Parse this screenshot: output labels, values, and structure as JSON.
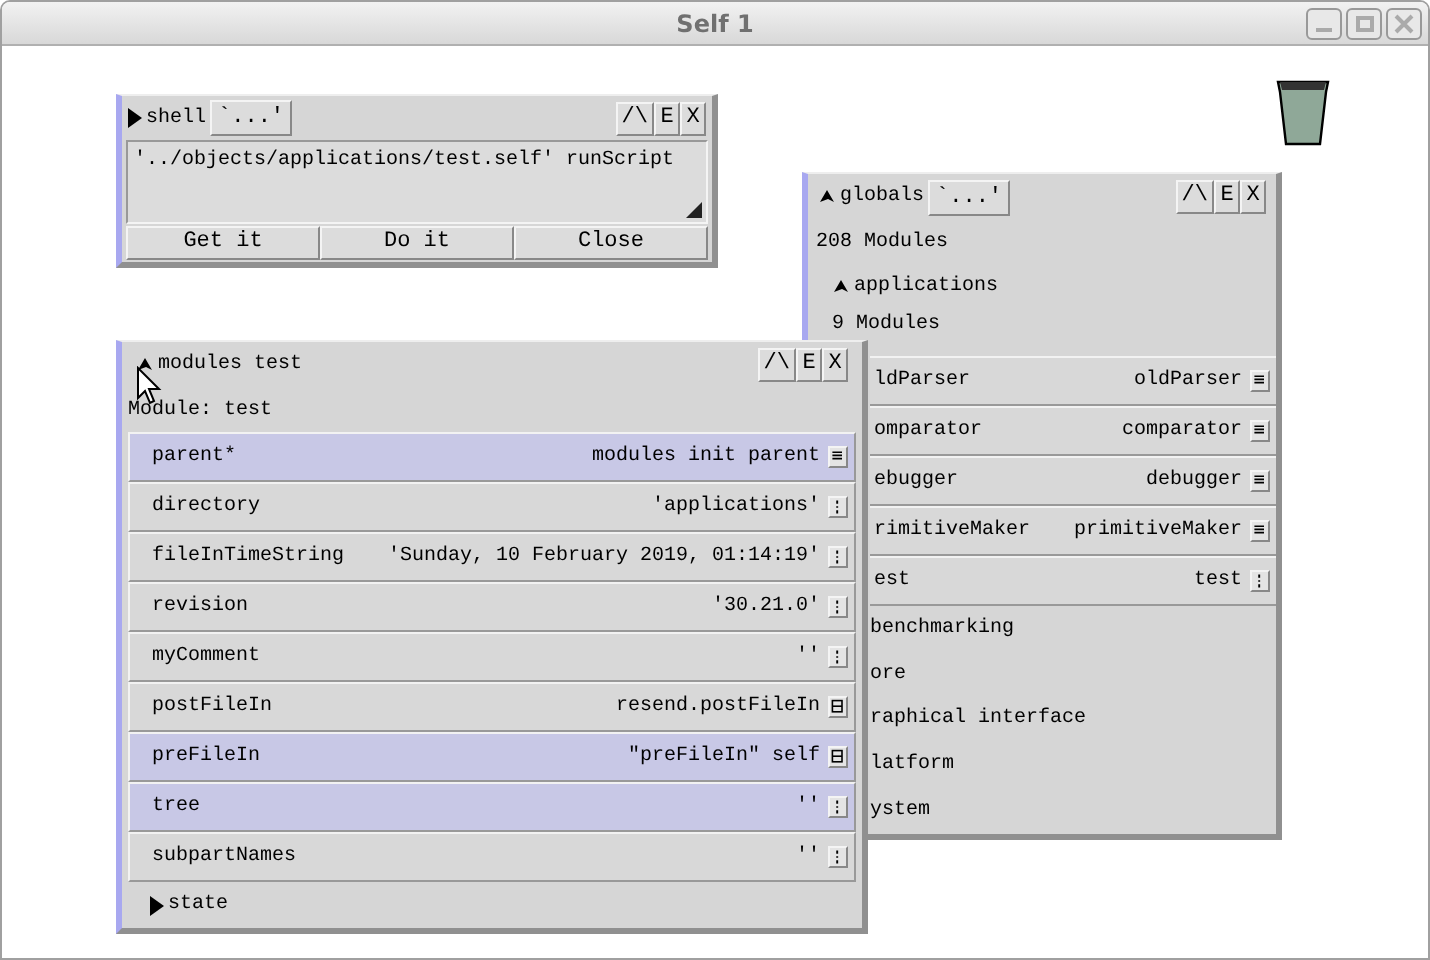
{
  "window": {
    "title": "Self 1"
  },
  "shell": {
    "expanded": false,
    "title": "shell",
    "menu_button": "`...'",
    "header_buttons": [
      "/\\",
      "E",
      "X"
    ],
    "text": "'../objects/applications/test.self' runScript",
    "buttons": [
      "Get it",
      "Do it",
      "Close"
    ]
  },
  "globals": {
    "expanded": true,
    "title": "globals",
    "menu_button": "`...'",
    "header_buttons": [
      "/\\",
      "E",
      "X"
    ],
    "count": "208 Modules",
    "group": {
      "title": "applications",
      "expanded": true,
      "count": "9 Modules"
    },
    "slots": [
      {
        "name": "ldParser",
        "value": "oldParser",
        "kind": "equals"
      },
      {
        "name": "omparator",
        "value": "comparator",
        "kind": "equals"
      },
      {
        "name": "ebugger",
        "value": "debugger",
        "kind": "equals"
      },
      {
        "name": "rimitiveMaker",
        "value": "primitiveMaker",
        "kind": "equals"
      },
      {
        "name": "est",
        "value": "test",
        "kind": "updown"
      }
    ],
    "categories": [
      "benchmarking",
      "ore",
      "raphical interface",
      "latform",
      "ystem"
    ]
  },
  "modules": {
    "expanded": true,
    "title": "modules test",
    "header_buttons": [
      "/\\",
      "E",
      "X"
    ],
    "subtitle": "Module: test",
    "slots": [
      {
        "name": "parent*",
        "value": "modules init parent",
        "kind": "equals",
        "selected": true
      },
      {
        "name": "directory",
        "value": "'applications'",
        "kind": "updown",
        "selected": false
      },
      {
        "name": "fileInTimeString",
        "value": "'Sunday, 10 February 2019, 01:14:19'",
        "kind": "updown",
        "selected": false
      },
      {
        "name": "revision",
        "value": "'30.21.0'",
        "kind": "updown",
        "selected": false
      },
      {
        "name": "myComment",
        "value": "''",
        "kind": "updown",
        "selected": false
      },
      {
        "name": "postFileIn",
        "value": "resend.postFileIn",
        "kind": "box",
        "selected": false
      },
      {
        "name": "preFileIn",
        "value": "\"preFileIn\" self",
        "kind": "box",
        "selected": true
      },
      {
        "name": "tree",
        "value": "''",
        "kind": "updown",
        "selected": true
      },
      {
        "name": "subpartNames",
        "value": "''",
        "kind": "updown",
        "selected": false
      }
    ],
    "sections": [
      {
        "title": "state",
        "expanded": false
      }
    ]
  }
}
